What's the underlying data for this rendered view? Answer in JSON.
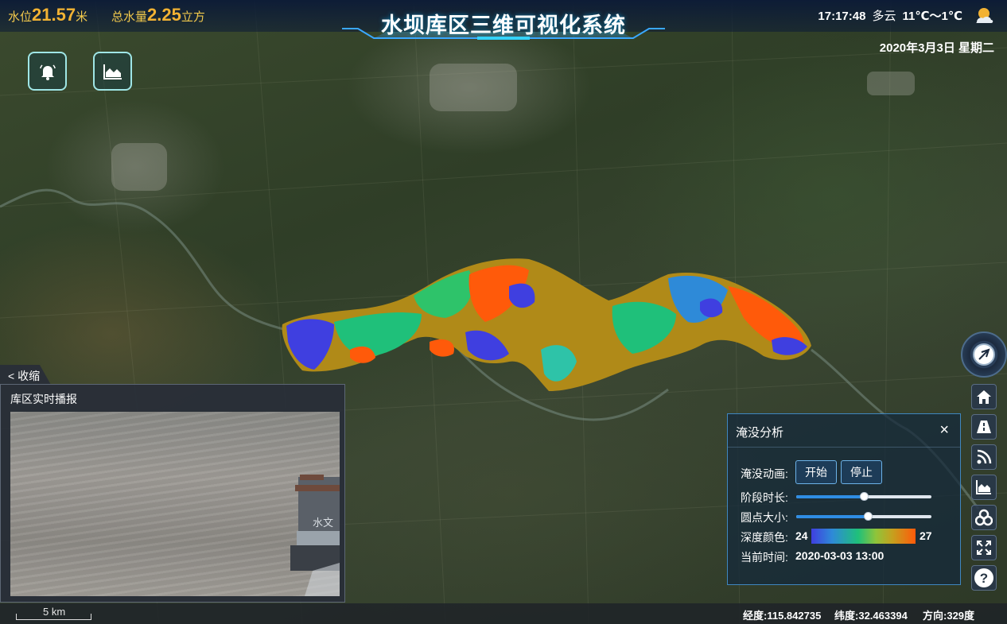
{
  "header": {
    "title": "水坝库区三维可视化系统",
    "water_level_label": "水位",
    "water_level_value": "21.57",
    "water_level_unit": "米",
    "total_volume_label": "总水量",
    "total_volume_value": "2.25",
    "total_volume_unit": "立方",
    "time": "17:17:48",
    "weather": "多云",
    "temperature": "11℃～1℃",
    "date": "2020年3月3日 星期二"
  },
  "toolbar": {
    "alarm_icon": "bell-icon",
    "chart_icon": "area-chart-icon"
  },
  "sidebar": {
    "compass_icon": "compass-icon",
    "buttons": [
      "home-icon",
      "road-icon",
      "rss-icon",
      "area-chart-icon",
      "layers-icon",
      "fullscreen-icon",
      "help-icon"
    ]
  },
  "flood_panel": {
    "title": "淹没分析",
    "close": "×",
    "animation_label": "淹没动画:",
    "start_button": "开始",
    "stop_button": "停止",
    "stage_duration_label": "阶段时长:",
    "stage_duration_value": 0.5,
    "dot_size_label": "圆点大小:",
    "dot_size_value": 0.53,
    "depth_color_label": "深度颜色:",
    "depth_min": "24",
    "depth_max": "27",
    "current_time_label": "当前时间:",
    "current_time_value": "2020-03-03 13:00"
  },
  "video_panel": {
    "collapse_label": "< 收缩",
    "title": "库区实时播报",
    "boat_text": "水文"
  },
  "statusbar": {
    "scale_label": "5 km",
    "longitude_label": "经度:",
    "longitude_value": "115.842735",
    "latitude_label": "纬度:",
    "latitude_value": "32.463394",
    "heading_label": "方向:",
    "heading_value": "329度"
  },
  "colors": {
    "accent": "#f2b233",
    "panel_border": "#3f86c0",
    "slider": "#2f8de4",
    "flood_low": "#3f3fe0",
    "flood_mid": "#1fc07a",
    "flood_high": "#ff5a0a",
    "flood_base": "#b08a18"
  }
}
